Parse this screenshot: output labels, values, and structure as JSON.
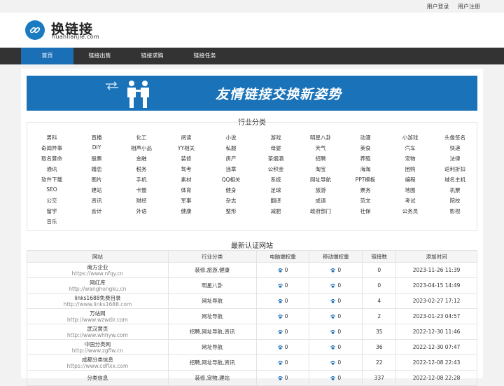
{
  "toplinks": {
    "login": "用户登录",
    "register": "用户注册"
  },
  "logo": {
    "title": "换链接",
    "subtitle": "huanlianjie.com"
  },
  "nav": [
    "首页",
    "链接出售",
    "链接求购",
    "链接任务"
  ],
  "banner": {
    "text": "友情链接交换新姿势"
  },
  "categories_title": "行业分类",
  "categories": [
    "男科",
    "直播",
    "化工",
    "阅读",
    "小说",
    "游戏",
    "明星八卦",
    "动漫",
    "小游戏",
    "头像签名",
    "奇闻异事",
    "DIY",
    "相声小品",
    "YY相关",
    "私服",
    "母婴",
    "天气",
    "美食",
    "汽车",
    "快递",
    "取名算命",
    "股票",
    "金融",
    "装修",
    "房产",
    "茶烟酒",
    "招聘",
    "养殖",
    "宠物",
    "法律",
    "通讯",
    "婚恋",
    "税务",
    "驾考",
    "违章",
    "公积金",
    "淘宝",
    "海淘",
    "团购",
    "返利折扣",
    "软件下载",
    "图片",
    "手机",
    "素材",
    "QQ相关",
    "系统",
    "网址导航",
    "PPT模板",
    "编程",
    "域名主机",
    "SEO",
    "建站",
    "卡盟",
    "体育",
    "健身",
    "足球",
    "旅游",
    "票务",
    "地图",
    "机票",
    "公交",
    "资讯",
    "财经",
    "军事",
    "杂志",
    "翻译",
    "成语",
    "范文",
    "考试",
    "院校",
    "留学",
    "会计",
    "外语",
    "健康",
    "整形",
    "减肥",
    "政府部门",
    "社保",
    "公务员",
    "影视",
    "音乐"
  ],
  "sites_title": "最新认证网站",
  "table": {
    "headers": [
      "网站",
      "行业分类",
      "电脑端权重",
      "移动端权重",
      "链接数",
      "添加时间"
    ],
    "rows": [
      {
        "name": "南方企业",
        "url": "https://www.nfqy.cn",
        "category": "装修,旅游,健康",
        "pc": "0",
        "mobile": "0",
        "links": "0",
        "time": "2023-11-26 11:39"
      },
      {
        "name": "网红库",
        "url": "http://wanghongku.cn",
        "category": "明星八卦",
        "pc": "0",
        "mobile": "0",
        "links": "0",
        "time": "2023-04-15 14:49"
      },
      {
        "name": "links1688免费目录",
        "url": "http://www.links1688.com",
        "category": "网址导航",
        "pc": "0",
        "mobile": "0",
        "links": "4",
        "time": "2023-02-27 17:12"
      },
      {
        "name": "万站网",
        "url": "http://www.wzwdir.com",
        "category": "网址导航",
        "pc": "0",
        "mobile": "0",
        "links": "2",
        "time": "2023-01-23 04:57"
      },
      {
        "name": "武汉黄页",
        "url": "http://www.whhyw.com",
        "category": "招聘,网址导航,资讯",
        "pc": "0",
        "mobile": "0",
        "links": "35",
        "time": "2022-12-30 11:46"
      },
      {
        "name": "中国分类网",
        "url": "http://www.zgflw.cn",
        "category": "网址导航",
        "pc": "0",
        "mobile": "0",
        "links": "36",
        "time": "2022-12-30 07:47"
      },
      {
        "name": "成都分类信息",
        "url": "https://www.cdflxx.com",
        "category": "招聘,网址导航,资讯",
        "pc": "0",
        "mobile": "0",
        "links": "22",
        "time": "2022-12-08 22:43"
      },
      {
        "name": "分类信息",
        "url": "",
        "category": "装修,宠物,建站",
        "pc": "0",
        "mobile": "0",
        "links": "337",
        "time": "2022-12-08 22:28"
      }
    ]
  },
  "colors": {
    "accent": "#1a6fb6",
    "nav_bg": "#333333",
    "banner_bg": "#1a73b8"
  }
}
